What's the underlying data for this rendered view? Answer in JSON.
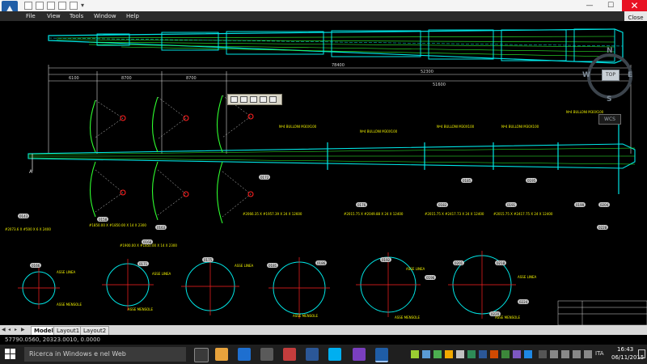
{
  "titlebar": {
    "close_label": "Close",
    "minimize_glyph": "—",
    "maximize_glyph": "☐",
    "close_glyph": "✕"
  },
  "menu": {
    "items": [
      "File",
      "View",
      "Tools",
      "Window",
      "Help"
    ]
  },
  "viewcube": {
    "north": "N",
    "south": "S",
    "west": "W",
    "east": "E",
    "top_face": "TOP",
    "wcs_label": "WCS"
  },
  "drawing": {
    "colors": {
      "outline": "#00e5e5",
      "members": "#2fff2f",
      "dimension": "#d8d8d8",
      "centerline": "#ff2020",
      "bubble_fill": "#c9c9c9",
      "label_text": "#f2f200"
    },
    "dimensions": {
      "top_overall": "78400",
      "top_right": "52300",
      "segments": [
        "6100",
        "8700",
        "8700"
      ],
      "segment_right": "51600"
    },
    "dotted_tag": "A",
    "section_bubbles": [
      "0166",
      "0171",
      "0175",
      "0181",
      "0186",
      "0192",
      "0196",
      "0201",
      "0218",
      "0220",
      "0224",
      "0228"
    ],
    "detail_bubbles": [
      "0143",
      "0158",
      "0163",
      "0168",
      "0172",
      "0176",
      "0182",
      "0185",
      "0191",
      "0195",
      "0199",
      "0204"
    ],
    "side_labels": [
      "ASSE LINEA",
      "ASSE MENSOLE",
      "ASSE LINEA",
      "ASSE MENSOLE",
      "ASSE LINEA",
      "ASSE MENSOLE",
      "ASSE LINEA",
      "ASSE MENSOLE",
      "ASSE LINEA",
      "ASSE MENSOLE"
    ],
    "bolt_notes": [
      "Nº4 BULLONI M30X100",
      "Nº4 BULLONI M30X100",
      "Nº4 BULLONI M30X100",
      "Nº4 BULLONI M30X100",
      "Nº4 BULLONI M30X100"
    ],
    "section_notes": [
      "#2066.35 X #1957.39 X 24 X 12600",
      "#2015.75 X #2049.88 X 24 X 12400",
      "#2015.75 X #2417.73 X 24 X 12400",
      "#2015.75 X #2417.75 X 24 X 12400"
    ],
    "lower_notes": [
      "#1900.00 X #1850.00 X 14 X 2300",
      "#1850.00 X #1850.00 X 14 X 2300"
    ],
    "left_note": "#2073.6 X #500 X 6 X 2400"
  },
  "layout_tabs": {
    "items": [
      "Model",
      "Layout1",
      "Layout2"
    ],
    "active": "Model"
  },
  "status": {
    "coordinates": "57790.0560, 20323.0010, 0.0000"
  },
  "taskbar": {
    "search_placeholder": "Ricerca in Windows e nel Web",
    "language": "ITA",
    "time": "16:43",
    "date": "06/11/2015"
  }
}
